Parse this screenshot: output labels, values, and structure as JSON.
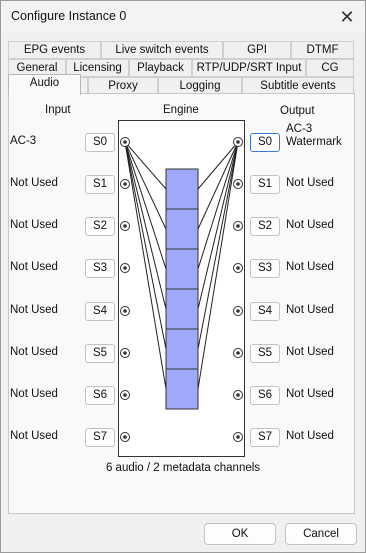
{
  "window": {
    "title": "Configure Instance 0"
  },
  "tabs": {
    "row1": [
      "EPG events",
      "Live switch events",
      "GPI",
      "DTMF"
    ],
    "row2": [
      "General",
      "Licensing",
      "Playback",
      "RTP/UDP/SRT Input",
      "CG"
    ],
    "row3": [
      "Audio",
      "Proxy",
      "Logging",
      "Subtitle events"
    ]
  },
  "audio": {
    "input_header": "Input",
    "engine_header": "Engine",
    "output_header": "Output",
    "inputs": [
      {
        "label": "AC-3",
        "button": "S0"
      },
      {
        "label": "Not Used",
        "button": "S1"
      },
      {
        "label": "Not Used",
        "button": "S2"
      },
      {
        "label": "Not Used",
        "button": "S3"
      },
      {
        "label": "Not Used",
        "button": "S4"
      },
      {
        "label": "Not Used",
        "button": "S5"
      },
      {
        "label": "Not Used",
        "button": "S6"
      },
      {
        "label": "Not Used",
        "button": "S7"
      }
    ],
    "outputs": [
      {
        "label": "AC-3 Watermark",
        "button": "S0"
      },
      {
        "label": "Not Used",
        "button": "S1"
      },
      {
        "label": "Not Used",
        "button": "S2"
      },
      {
        "label": "Not Used",
        "button": "S3"
      },
      {
        "label": "Not Used",
        "button": "S4"
      },
      {
        "label": "Not Used",
        "button": "S5"
      },
      {
        "label": "Not Used",
        "button": "S6"
      },
      {
        "label": "Not Used",
        "button": "S7"
      }
    ],
    "channel_count": 6,
    "channels_summary": "6 audio / 2 metadata channels"
  },
  "buttons": {
    "ok": "OK",
    "cancel": "Cancel"
  },
  "colors": {
    "channel_fill": "#9fa8f9",
    "focus_border": "#3a7bd5"
  }
}
